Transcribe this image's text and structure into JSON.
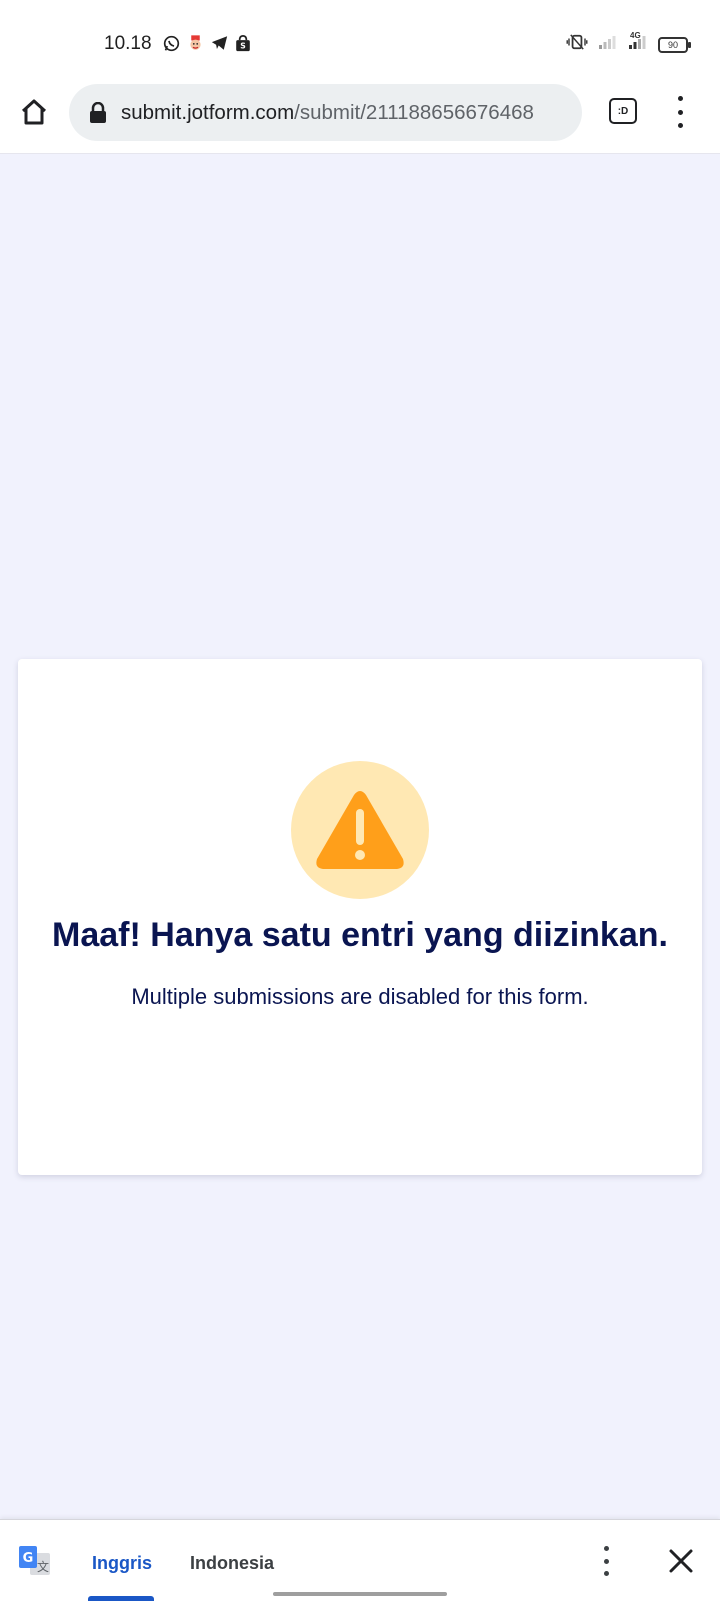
{
  "status_bar": {
    "time": "10.18",
    "app_icons": [
      "whatsapp-icon",
      "game-avatar-icon",
      "telegram-icon",
      "shopee-bag-icon"
    ],
    "right_icons": [
      "vibrate-icon",
      "signal-weak-icon",
      "signal-4g-icon"
    ],
    "network_type": "4G",
    "battery_level": "90"
  },
  "browser": {
    "url_host": "submit.jotform.com",
    "url_path": "/submit/211188656676468",
    "tab_label": ":D"
  },
  "card": {
    "title": "Maaf! Hanya satu entri yang diizinkan.",
    "message": "Multiple submissions are disabled for this form.",
    "icon": "warning-triangle-icon",
    "icon_color": "#ff9f1a",
    "icon_bg": "#ffe8b3",
    "title_color": "#0a1551"
  },
  "translate_bar": {
    "active_language": "Inggris",
    "other_language": "Indonesia",
    "active_color": "#1a57c6"
  }
}
